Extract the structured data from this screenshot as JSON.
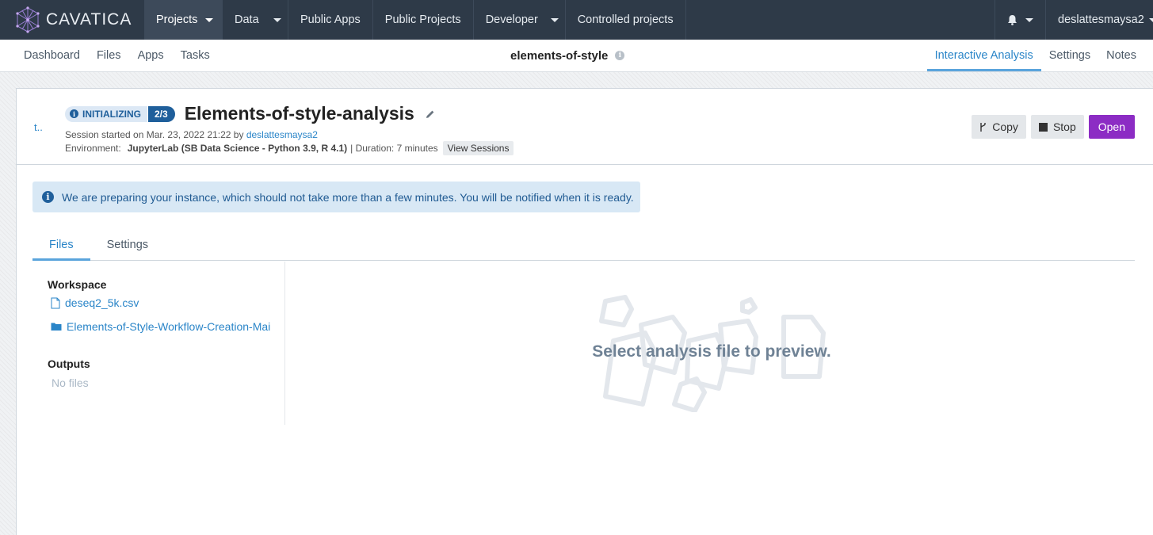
{
  "topnav": {
    "brand": "CAVATICA",
    "items": [
      {
        "label": "Projects",
        "dropdown": true,
        "active": true
      },
      {
        "label": "Data",
        "dropdown": true
      },
      {
        "label": "Public Apps"
      },
      {
        "label": "Public Projects"
      },
      {
        "label": "Developer",
        "dropdown": true
      },
      {
        "label": "Controlled projects"
      }
    ],
    "user": "deslattesmaysa2"
  },
  "subnav": {
    "left": [
      "Dashboard",
      "Files",
      "Apps",
      "Tasks"
    ],
    "project_title": "elements-of-style",
    "right": [
      "Interactive Analysis",
      "Settings",
      "Notes"
    ],
    "active_right": "Interactive Analysis"
  },
  "analysis": {
    "back": "t..",
    "status": "INITIALIZING",
    "step": "2/3",
    "title": "Elements-of-style-analysis",
    "session_prefix": "Session started on Mar. 23, 2022 21:22 by",
    "session_user": "deslattesmaysa2",
    "env_label": "Environment:",
    "env_value": "JupyterLab (SB Data Science - Python 3.9, R 4.1)",
    "duration": "| Duration: 7 minutes",
    "view_sessions": "View Sessions"
  },
  "actions": {
    "copy": "Copy",
    "stop": "Stop",
    "open": "Open"
  },
  "alert": {
    "text": "We are preparing your instance, which should not take more than a few minutes. You will be notified when it is ready."
  },
  "tabs": [
    {
      "label": "Files",
      "active": true
    },
    {
      "label": "Settings"
    }
  ],
  "sidebar": {
    "workspace_heading": "Workspace",
    "workspace_items": [
      {
        "label": "deseq2_5k.csv",
        "type": "file"
      },
      {
        "label": "Elements-of-Style-Workflow-Creation-Mai",
        "type": "folder"
      }
    ],
    "outputs_heading": "Outputs",
    "outputs_empty": "No files"
  },
  "preview": {
    "message": "Select analysis file to preview."
  },
  "colors": {
    "topnav_bg": "#2e3a48",
    "link": "#2a85c8",
    "open_button": "#8c2cc4",
    "status_dark": "#1f5f9b"
  }
}
